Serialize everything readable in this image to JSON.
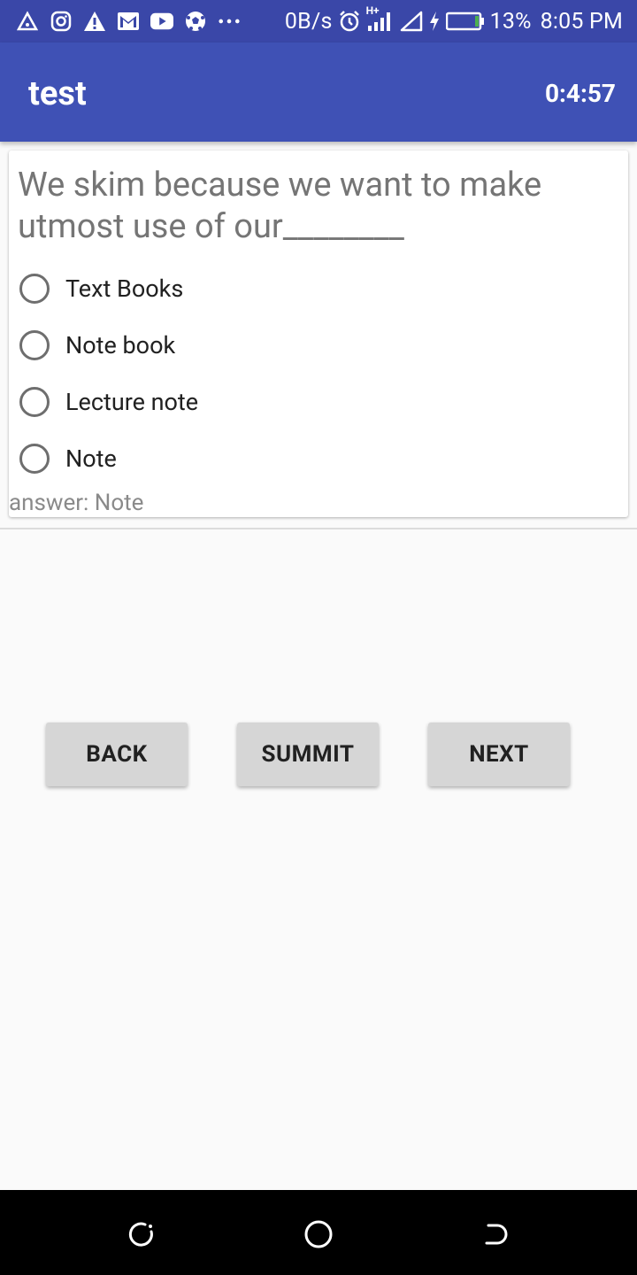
{
  "status_bar": {
    "net_speed": "0B/s",
    "network": "H+",
    "battery": "13%",
    "time": "8:05 PM",
    "notification_icons": [
      "warning-triangle-outline-icon",
      "instagram-icon",
      "alert-icon",
      "gmail-icon",
      "youtube-icon",
      "soccer-ball-icon",
      "more-dots-icon"
    ],
    "system_icons": [
      "alarm-icon",
      "signal-icon",
      "no-sim-signal-icon",
      "charging-icon",
      "battery-icon"
    ]
  },
  "app_bar": {
    "title": "test",
    "timer": "0:4:57"
  },
  "quiz": {
    "question": "We skim because we want to make utmost use of our________",
    "options": [
      {
        "label": "Text Books"
      },
      {
        "label": "Note book"
      },
      {
        "label": "Lecture note"
      },
      {
        "label": "Note"
      }
    ],
    "answer": "answer: Note"
  },
  "buttons": {
    "back": "BACK",
    "submit": "SUMMIT",
    "next": "NEXT"
  },
  "nav_bar": {
    "icons": [
      "recents-icon",
      "home-icon",
      "back-icon"
    ]
  },
  "colors": {
    "status_bar": "#3a47a8",
    "app_bar": "#3f51b5",
    "button": "#d6d6d6",
    "background": "#fafafa"
  }
}
